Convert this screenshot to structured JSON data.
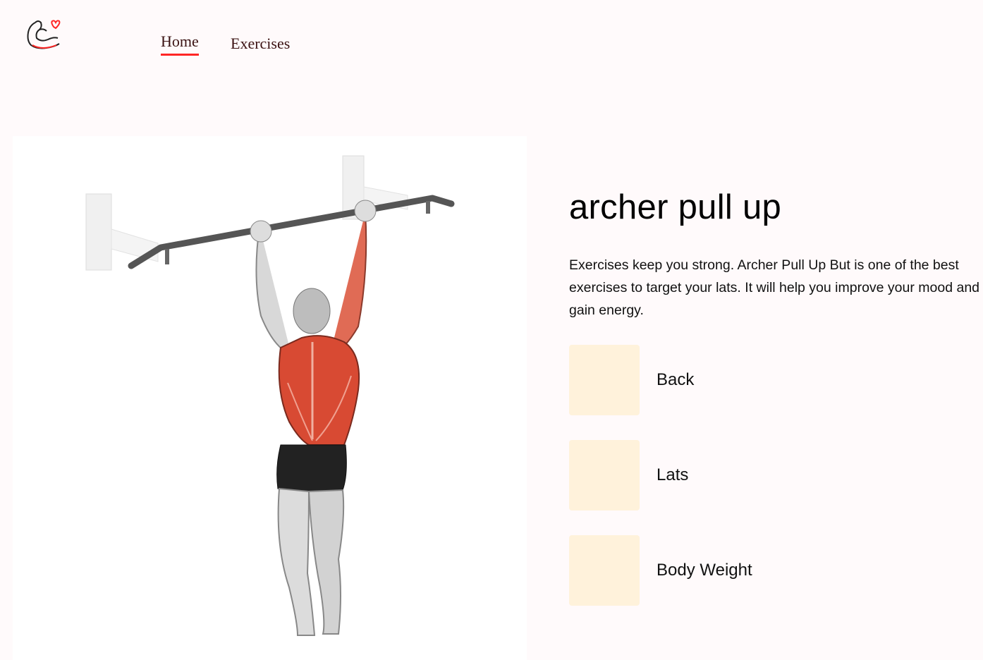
{
  "nav": {
    "logo_icon": "flexed-arm-heart-icon",
    "home_label": "Home",
    "exercises_label": "Exercises",
    "accent_color": "#ff2625"
  },
  "exercise": {
    "name": "archer pull up",
    "description": "Exercises keep you strong. Archer Pull Up But is one of the best exercises to target your lats. It will help you improve your mood and gain energy.",
    "image": "pull-up-illustration",
    "details": [
      {
        "icon": "body-part-icon",
        "label": "Back"
      },
      {
        "icon": "target-muscle-icon",
        "label": "Lats"
      },
      {
        "icon": "equipment-icon",
        "label": "Body Weight"
      }
    ]
  }
}
